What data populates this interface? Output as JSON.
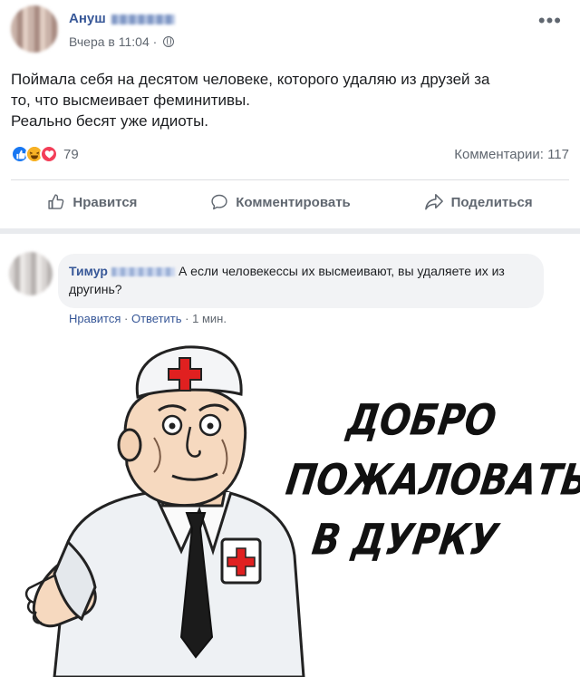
{
  "post": {
    "author": "Ануш",
    "time": "Вчера в 11:04",
    "separator": "·",
    "text_lines": [
      "Поймала себя на десятом человеке, которого удаляю из друзей за",
      "то, что высмеивает феминитивы.",
      "Реально бесят уже идиоты."
    ],
    "reactions_count": "79",
    "comments_count": "Комментарии: 117",
    "actions": {
      "like": "Нравится",
      "comment": "Комментировать",
      "share": "Поделиться"
    },
    "icons": [
      "globe-icon",
      "more-icon",
      "like-icon",
      "haha-icon",
      "love-icon",
      "thumbs-up-icon",
      "comment-icon",
      "share-icon"
    ]
  },
  "comment": {
    "author": "Тимур",
    "text": "А если человекессы их высмеивают, вы удаляете их из другинь?",
    "like": "Нравится",
    "reply": "Ответить",
    "time": "1 мин.",
    "dot": "·"
  },
  "meme": {
    "lines": [
      "ДОБРО",
      "ПОЖАЛОВАТЬ",
      "В ДУРКУ"
    ]
  },
  "colors": {
    "link": "#385898",
    "muted": "#606770",
    "like": "#1877f2",
    "love": "#f33e58",
    "haha": "#f7b125",
    "red_cross": "#e02020"
  }
}
